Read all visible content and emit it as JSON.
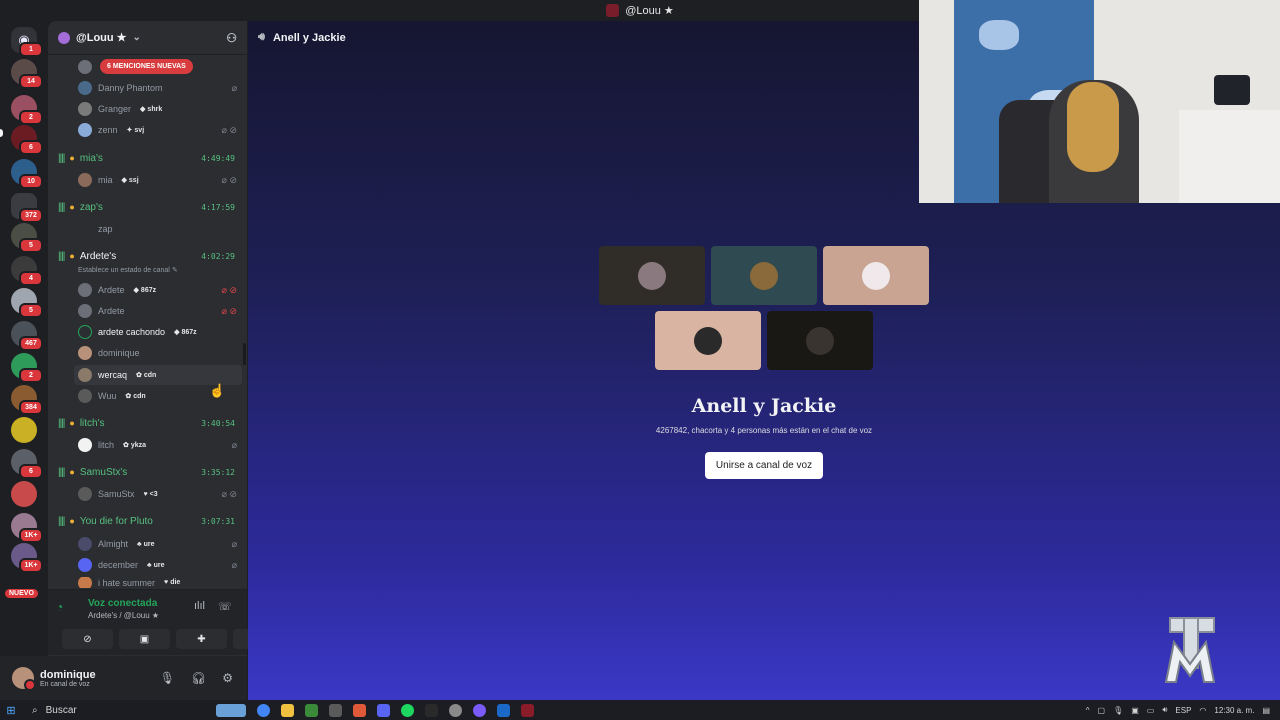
{
  "window": {
    "title": "@Louu ★"
  },
  "guild": {
    "name": "@Louu ★"
  },
  "mentions_banner": "6 MENCIONES NUEVAS",
  "rail": {
    "badges": [
      "1",
      "14",
      "2",
      "6",
      "10",
      "372",
      "5",
      "4",
      "5",
      "467",
      "2",
      "384",
      "6",
      "1K+",
      "1K+"
    ],
    "new_label": "NUEVO"
  },
  "channels": [
    {
      "name": "",
      "members": [
        {
          "name": "Danny Phantom",
          "tag": ""
        },
        {
          "name": "Granger",
          "tag": "shrk"
        },
        {
          "name": "zenn",
          "tag": "svj"
        }
      ]
    },
    {
      "name": "mia's",
      "time": "4:49:49",
      "members": [
        {
          "name": "mia",
          "tag": "ssj"
        }
      ]
    },
    {
      "name": "zap's",
      "time": "4:17:59",
      "members": [
        {
          "name": "zap",
          "tag": ""
        }
      ]
    },
    {
      "name": "Ardete's",
      "time": "4:02:29",
      "status": "Establece un estado de canal",
      "members": [
        {
          "name": "Ardete",
          "tag": "867z"
        },
        {
          "name": "Ardete",
          "tag": ""
        },
        {
          "name": "ardete cachondo",
          "tag": "867z"
        },
        {
          "name": "dominique",
          "tag": ""
        },
        {
          "name": "wercaq",
          "tag": "cdn"
        },
        {
          "name": "Wuu",
          "tag": "cdn"
        }
      ]
    },
    {
      "name": "litch's",
      "time": "3:40:54",
      "members": [
        {
          "name": "litch",
          "tag": "ykza"
        }
      ]
    },
    {
      "name": "SamuStx's",
      "time": "3:35:12",
      "members": [
        {
          "name": "SamuStx",
          "tag": "<3"
        }
      ]
    },
    {
      "name": "You die for Pluto",
      "time": "3:07:31",
      "members": [
        {
          "name": "Almight",
          "tag": "ure"
        },
        {
          "name": "december",
          "tag": "ure"
        },
        {
          "name": "i hate summer",
          "tag": "die"
        }
      ]
    }
  ],
  "voice_connected": {
    "title": "Voz conectada",
    "subtitle": "Ardete's / @Louu ★"
  },
  "user": {
    "name": "dominique",
    "status": "En canal de voz"
  },
  "stage": {
    "header": "Anell y Jackie",
    "title": "Anell y Jackie",
    "members_text": "4267842, chacorta y 4 personas más están en el chat de voz",
    "join_label": "Unirse a canal de voz",
    "tile_colors": [
      "#302c28",
      "#2f4a50",
      "#c9a493",
      "#d9b4a2",
      "#1a1814"
    ]
  },
  "taskbar": {
    "search_placeholder": "Buscar",
    "lang": "ESP",
    "clock": "12:30 a. m."
  },
  "colors": {
    "speaking_green": "#57c07f",
    "mention_red": "#d83c3e",
    "stage_gradient_top": "#161631",
    "stage_gradient_bottom": "#3b38c6"
  }
}
